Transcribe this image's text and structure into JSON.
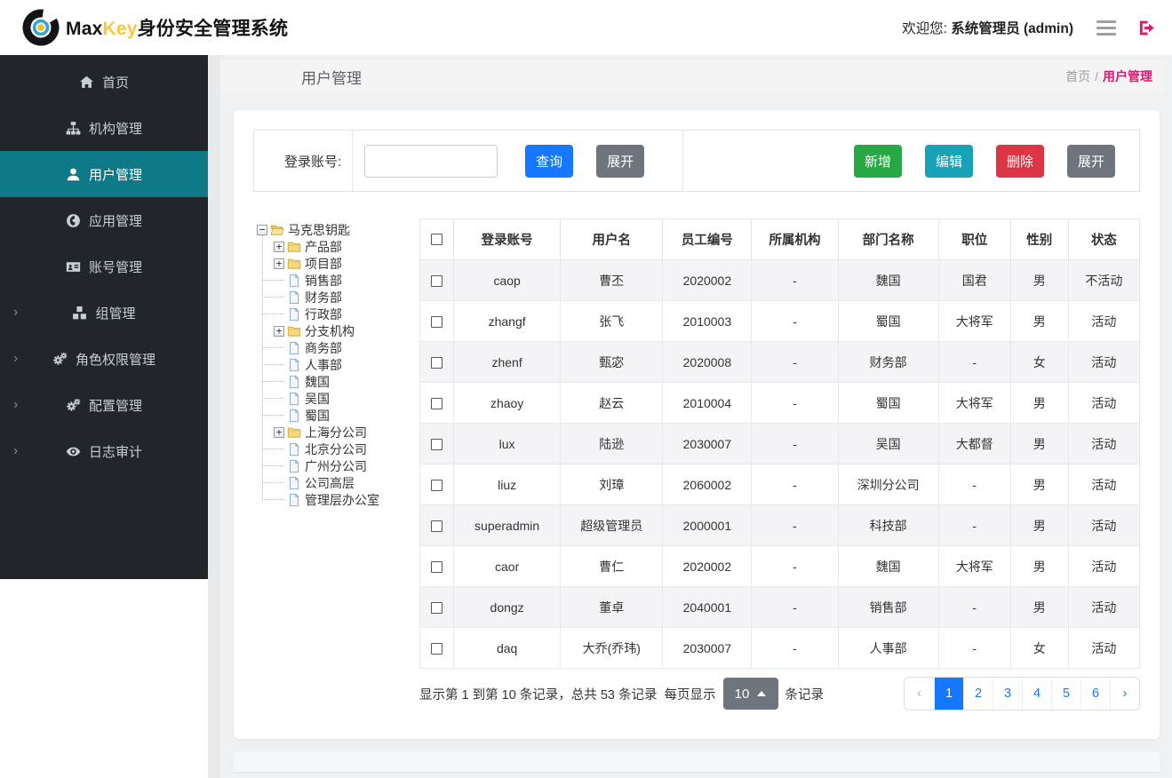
{
  "header": {
    "brand_max": "Max",
    "brand_key": "Key",
    "brand_suffix": "身份安全管理系统",
    "welcome_prefix": "欢迎您:",
    "welcome_user": "系统管理员 (admin)"
  },
  "sidebar": {
    "items": [
      {
        "label": "首页",
        "icon": "home-icon",
        "active": false,
        "expandable": false
      },
      {
        "label": "机构管理",
        "icon": "sitemap-icon",
        "active": false,
        "expandable": false
      },
      {
        "label": "用户管理",
        "icon": "user-icon",
        "active": true,
        "expandable": false
      },
      {
        "label": "应用管理",
        "icon": "globe-icon",
        "active": false,
        "expandable": false
      },
      {
        "label": "账号管理",
        "icon": "id-card-icon",
        "active": false,
        "expandable": false
      },
      {
        "label": "组管理",
        "icon": "cubes-icon",
        "active": false,
        "expandable": true
      },
      {
        "label": "角色权限管理",
        "icon": "gears-icon",
        "active": false,
        "expandable": true
      },
      {
        "label": "配置管理",
        "icon": "gears-icon",
        "active": false,
        "expandable": true
      },
      {
        "label": "日志审计",
        "icon": "eye-icon",
        "active": false,
        "expandable": true
      }
    ]
  },
  "page": {
    "title": "用户管理",
    "breadcrumb_home": "首页",
    "breadcrumb_sep": "/",
    "breadcrumb_current": "用户管理"
  },
  "toolbar": {
    "search_label": "登录账号:",
    "search_value": "",
    "query_label": "查询",
    "expand_label": "展开",
    "add_label": "新增",
    "edit_label": "编辑",
    "delete_label": "删除",
    "expand2_label": "展开"
  },
  "tree": {
    "root": {
      "label": "马克思钥匙",
      "toggle": "−"
    },
    "nodes": [
      {
        "label": "产品部",
        "type": "branch",
        "toggle": "+"
      },
      {
        "label": "项目部",
        "type": "branch",
        "toggle": "+"
      },
      {
        "label": "销售部",
        "type": "leaf"
      },
      {
        "label": "财务部",
        "type": "leaf"
      },
      {
        "label": "行政部",
        "type": "leaf"
      },
      {
        "label": "分支机构",
        "type": "branch",
        "toggle": "+"
      },
      {
        "label": "商务部",
        "type": "leaf"
      },
      {
        "label": "人事部",
        "type": "leaf"
      },
      {
        "label": "魏国",
        "type": "leaf"
      },
      {
        "label": "吴国",
        "type": "leaf"
      },
      {
        "label": "蜀国",
        "type": "leaf"
      },
      {
        "label": "上海分公司",
        "type": "branch",
        "toggle": "+"
      },
      {
        "label": "北京分公司",
        "type": "leaf"
      },
      {
        "label": "广州分公司",
        "type": "leaf"
      },
      {
        "label": "公司高层",
        "type": "leaf"
      },
      {
        "label": "管理层办公室",
        "type": "leaf"
      }
    ]
  },
  "table": {
    "headers": [
      "登录账号",
      "用户名",
      "员工编号",
      "所属机构",
      "部门名称",
      "职位",
      "性别",
      "状态"
    ],
    "rows": [
      [
        "caop",
        "曹丕",
        "2020002",
        "-",
        "魏国",
        "国君",
        "男",
        "不活动"
      ],
      [
        "zhangf",
        "张飞",
        "2010003",
        "-",
        "蜀国",
        "大将军",
        "男",
        "活动"
      ],
      [
        "zhenf",
        "甄宓",
        "2020008",
        "-",
        "财务部",
        "-",
        "女",
        "活动"
      ],
      [
        "zhaoy",
        "赵云",
        "2010004",
        "-",
        "蜀国",
        "大将军",
        "男",
        "活动"
      ],
      [
        "lux",
        "陆逊",
        "2030007",
        "-",
        "吴国",
        "大都督",
        "男",
        "活动"
      ],
      [
        "liuz",
        "刘璋",
        "2060002",
        "-",
        "深圳分公司",
        "-",
        "男",
        "活动"
      ],
      [
        "superadmin",
        "超级管理员",
        "2000001",
        "-",
        "科技部",
        "-",
        "男",
        "活动"
      ],
      [
        "caor",
        "曹仁",
        "2020002",
        "-",
        "魏国",
        "大将军",
        "男",
        "活动"
      ],
      [
        "dongz",
        "董卓",
        "2040001",
        "-",
        "销售部",
        "-",
        "男",
        "活动"
      ],
      [
        "daq",
        "大乔(乔玮)",
        "2030007",
        "-",
        "人事部",
        "-",
        "女",
        "活动"
      ]
    ]
  },
  "pagination": {
    "summary": "显示第 1 到第 10 条记录，总共 53 条记录",
    "per_page_prefix": "每页显示",
    "page_size": "10",
    "per_page_suffix": "条记录",
    "prev": "‹",
    "next": "›",
    "pages": [
      "1",
      "2",
      "3",
      "4",
      "5",
      "6"
    ],
    "active_page": "1"
  },
  "colors": {
    "brand_key_yellow": "#ffc53d",
    "breadcrumb_pink": "#e6156f",
    "primary_blue": "#1677ff",
    "success_green": "#28a745",
    "info_teal": "#17a2b8",
    "danger_red": "#dc3545",
    "secondary_gray": "#6e757c",
    "sidebar_dark": "#22262a",
    "active_item_teal": "#0e7987"
  }
}
